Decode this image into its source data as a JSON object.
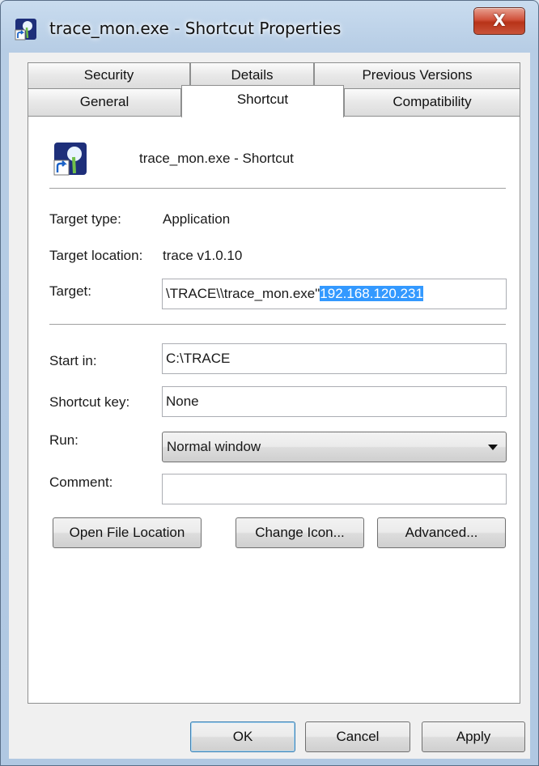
{
  "window": {
    "title": "trace_mon.exe - Shortcut Properties",
    "close_glyph": "X",
    "title_icon": "shortcut-app-icon"
  },
  "tabs": {
    "row_back": [
      {
        "label": "Security"
      },
      {
        "label": "Details"
      },
      {
        "label": "Previous Versions"
      }
    ],
    "row_front": [
      {
        "label": "General"
      },
      {
        "label": "Shortcut",
        "selected": true
      },
      {
        "label": "Compatibility"
      }
    ]
  },
  "shortcut": {
    "icon": "shortcut-app-icon",
    "name": "trace_mon.exe - Shortcut",
    "target_type_label": "Target type:",
    "target_type_value": "Application",
    "target_location_label": "Target location:",
    "target_location_value": "trace v1.0.10",
    "target_label": "Target:",
    "target_value_plain": "\\TRACE\\\\trace_mon.exe\"",
    "target_value_selected": "192.168.120.231",
    "start_in_label": "Start in:",
    "start_in_value": "C:\\TRACE",
    "shortcut_key_label": "Shortcut key:",
    "shortcut_key_value": "None",
    "run_label": "Run:",
    "run_value": "Normal window",
    "comment_label": "Comment:",
    "comment_value": ""
  },
  "action_buttons": {
    "open_file_location": "Open File Location",
    "change_icon": "Change Icon...",
    "advanced": "Advanced..."
  },
  "dialog_buttons": {
    "ok": "OK",
    "cancel": "Cancel",
    "apply": "Apply"
  },
  "colors": {
    "selection": "#3399ff",
    "close_button": "#c9533a",
    "window_frame": "#b7cde5"
  }
}
